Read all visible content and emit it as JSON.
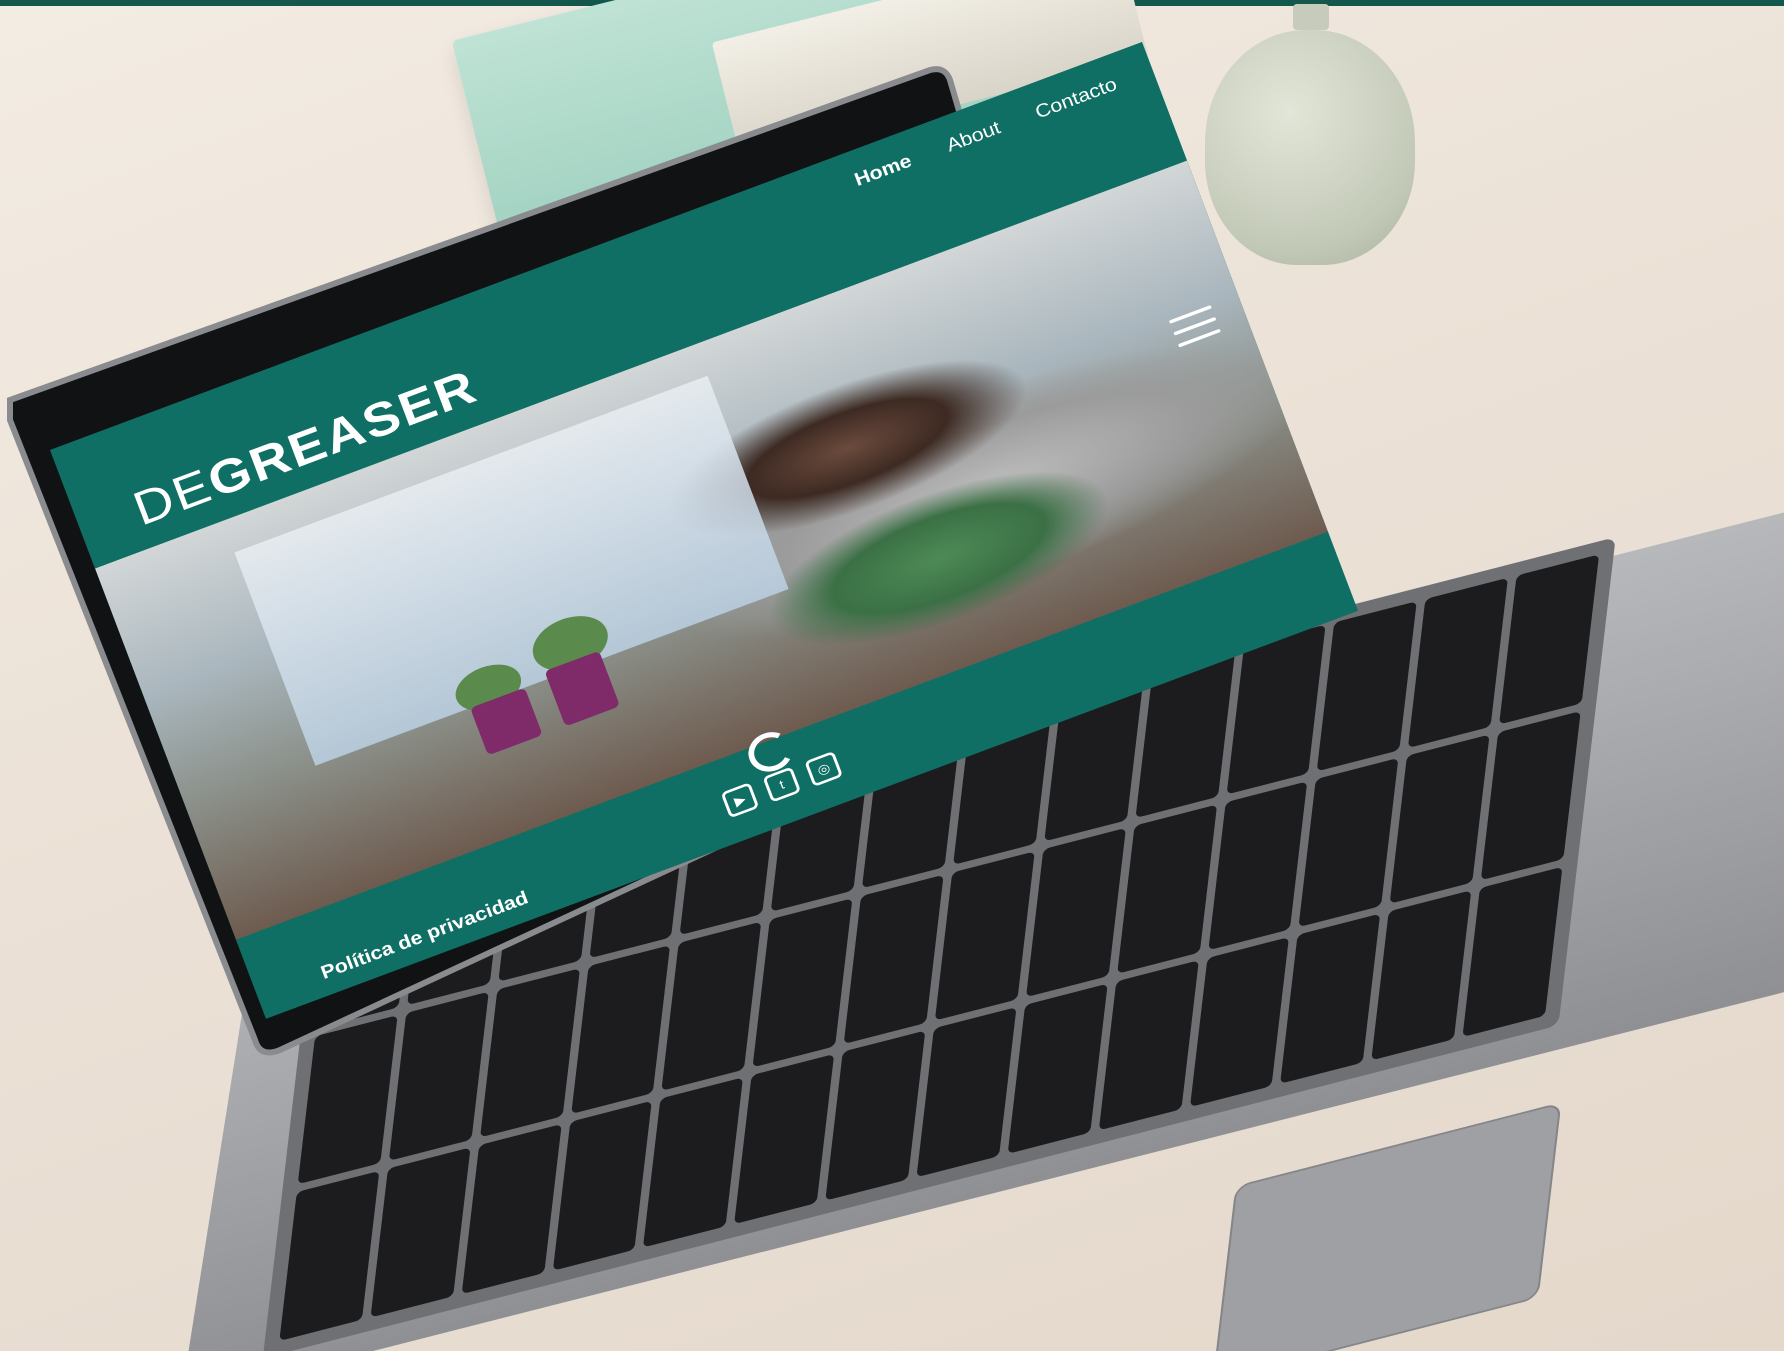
{
  "site": {
    "logo_prefix": "DE",
    "logo_rest": "GREASER",
    "nav": [
      {
        "label": "Home",
        "active": true
      },
      {
        "label": "About",
        "active": false
      },
      {
        "label": "Contacto",
        "active": false
      }
    ],
    "menu_icon": "hamburger-menu-icon",
    "footer_link": "Política de privacidad",
    "social_icons": [
      "youtube-icon",
      "twitter-icon",
      "instagram-icon"
    ],
    "colors": {
      "brand_teal": "#0f6f64",
      "text_on_brand": "#ffffff"
    }
  }
}
